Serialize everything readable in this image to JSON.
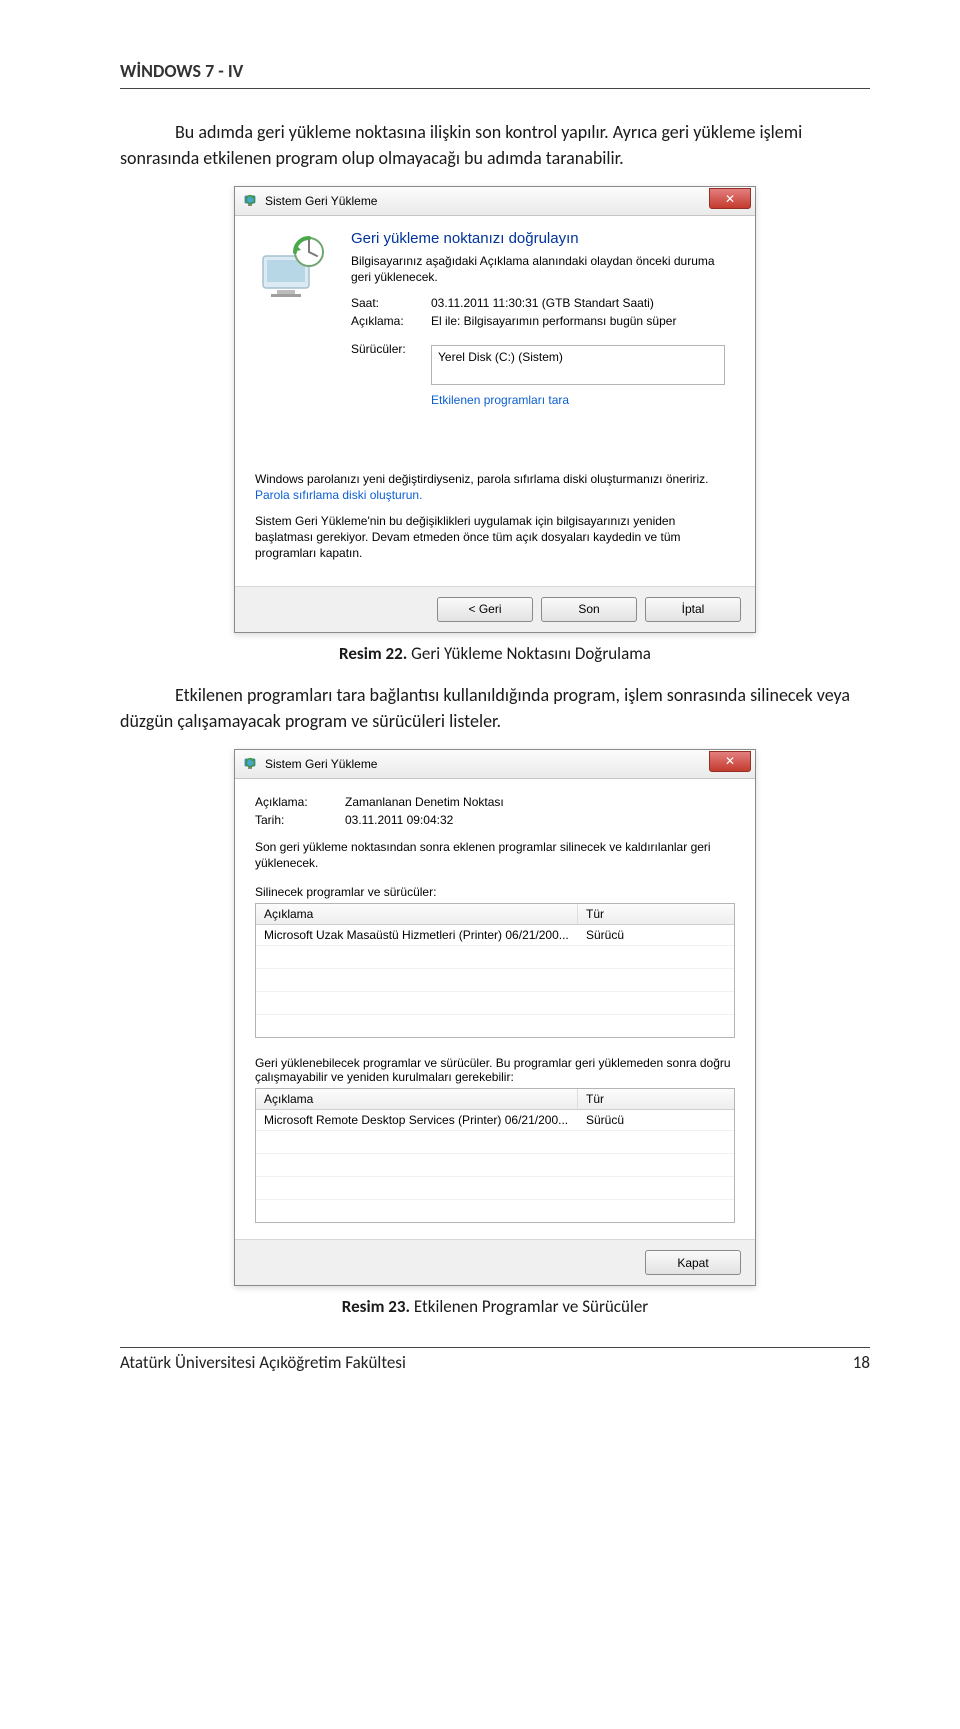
{
  "page": {
    "header": "WİNDOWS 7 - IV",
    "paragraph1": "Bu adımda geri yükleme noktasına ilişkin son kontrol yapılır. Ayrıca geri yükleme işlemi sonrasında etkilenen program olup olmayacağı bu adımda taranabilir.",
    "caption1_label": "Resim 22.",
    "caption1_text": " Geri Yükleme Noktasını Doğrulama",
    "paragraph2": "Etkilenen programları tara bağlantısı kullanıldığında program, işlem sonrasında silinecek veya düzgün çalışamayacak program ve sürücüleri listeler.",
    "caption2_label": "Resim 23.",
    "caption2_text": " Etkilenen Programlar ve Sürücüler",
    "footer_left": "Atatürk Üniversitesi Açıköğretim Fakültesi",
    "footer_right": "18"
  },
  "dialog1": {
    "title": "Sistem Geri Yükleme",
    "heading": "Geri yükleme noktanızı doğrulayın",
    "subheading": "Bilgisayarınız aşağıdaki Açıklama alanındaki olaydan önceki duruma geri yüklenecek.",
    "saat_label": "Saat:",
    "saat_value": "03.11.2011 11:30:31 (GTB Standart Saati)",
    "aciklama_label": "Açıklama:",
    "aciklama_value": "El ile: Bilgisayarımın performansı bugün süper",
    "suruculer_label": "Sürücüler:",
    "suruculer_value": "Yerel Disk (C:) (Sistem)",
    "scan_link": "Etkilenen programları tara",
    "warn1a": "Windows parolanızı yeni değiştirdiyseniz, parola sıfırlama diski oluşturmanızı öneririz. ",
    "warn1_link": "Parola sıfırlama diski oluşturun.",
    "warn2": "Sistem Geri Yükleme'nin bu değişiklikleri uygulamak için bilgisayarınızı yeniden başlatması gerekiyor. Devam etmeden önce tüm açık dosyaları kaydedin ve tüm programları kapatın.",
    "btn_back": "< Geri",
    "btn_finish": "Son",
    "btn_cancel": "İptal"
  },
  "dialog2": {
    "title": "Sistem Geri Yükleme",
    "aciklama_label": "Açıklama:",
    "aciklama_value": "Zamanlanan Denetim Noktası",
    "tarih_label": "Tarih:",
    "tarih_value": "03.11.2011 09:04:32",
    "intro": "Son geri yükleme noktasından sonra eklenen programlar silinecek ve kaldırılanlar geri yüklenecek.",
    "section1_label": "Silinecek programlar ve sürücüler:",
    "col_desc": "Açıklama",
    "col_type": "Tür",
    "row1_desc": "Microsoft Uzak Masaüstü Hizmetleri (Printer) 06/21/200...",
    "row1_type": "Sürücü",
    "section2_label": "Geri yüklenebilecek programlar ve sürücüler. Bu programlar geri yüklemeden sonra doğru çalışmayabilir ve yeniden kurulmaları gerekebilir:",
    "row2_desc": "Microsoft Remote Desktop Services (Printer) 06/21/200...",
    "row2_type": "Sürücü",
    "btn_close": "Kapat"
  }
}
